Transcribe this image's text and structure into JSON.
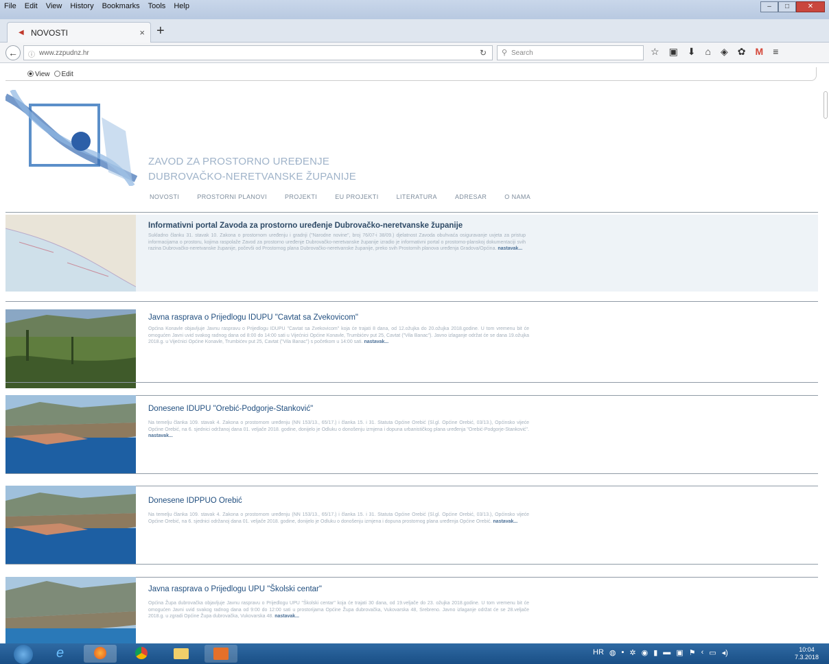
{
  "browser": {
    "menu": [
      "File",
      "Edit",
      "View",
      "History",
      "Bookmarks",
      "Tools",
      "Help"
    ],
    "tab_title": "NOVOSTI",
    "url": "www.zzpudnz.hr",
    "search_placeholder": "Search"
  },
  "page": {
    "mode_view": "View",
    "mode_edit": "Edit",
    "site_title_line1": "ZAVOD ZA PROSTORNO UREĐENJE",
    "site_title_line2": "DUBROVAČKO-NERETVANSKE ŽUPANIJE",
    "nav": [
      "NOVOSTI",
      "PROSTORNI PLANOVI",
      "PROJEKTI",
      "EU PROJEKTI",
      "LITERATURA",
      "ADRESAR",
      "O NAMA"
    ],
    "read_more": "nastavak...",
    "featured": {
      "title": "Informativni portal Zavoda za prostorno uređenje Dubrovačko-neretvanske županije",
      "text": "Sukladno članku 31. stavak 10. Zakona o prostornom uređenju i gradnji (\"Narodne novine\", broj 76/07-i 38/09.) djelatnost Zavoda obuhvaća osiguravanje uvjeta za pristup informacijama o prostoru, kojima raspolaže Zavod za prostorno uređenje Dubrovačko-neretvanske županije izradio je informativni portal o prostorno-planskoj dokumentaciji svih razina Dubrovačko-neretvanske županije, počevši od Prostornog plana Dubrovačko-neretvanske županije, preko svih Prostornih planova uređenja Gradova/Općina."
    },
    "articles": [
      {
        "title": "Javna rasprava o Prijedlogu IDUPU \"Cavtat sa Zvekovicom\"",
        "text": "Općina Konavle objavljuje Javnu raspravu o Prijedlogu IDUPU \"Cavtat sa Zvekovicom\" koja će trajati 8 dana, od 12.ožujka do 20.ožujka 2018.godine. U tom vremenu bit će omogućen Javni uvid svakog radnog dana od 8:00 do 14:00 sati u Vijećnici Općine Konavle, Trumbićev put 25, Cavtat (\"Vila Banac\"). Javno izlaganje održat će se dana 19.ožujka 2018.g. u Vijećnici Općine Konavle, Trumbićev put 25, Cavtat (\"Vila Banac\") s početkom u 14:00 sati."
      },
      {
        "title": "Donesene IDUPU \"Orebić-Podgorje-Stanković\"",
        "text": "Na temelju članka 109. stavak 4. Zakona o prostornom uređenju (NN 153/13., 65/17.) i članka 15. i 31. Statuta Općine Orebić (Sl.gl. Općine Orebić, 03/13.), Općinsko vijeće Općine Orebić, na 6. sjednici održanoj dana 01. veljače 2018. godine, donijelo je Odluku o donošenju izmjena i dopuna urbanističkog plana uređenja \"Orebić-Podgorje-Stanković\"."
      },
      {
        "title": "Donesene IDPPUO Orebić",
        "text": "Na temelju članka 109. stavak 4. Zakona o prostornom uređenju (NN 153/13., 65/17.) i članka 15. i 31. Statuta Općine Orebić (Sl.gl. Općine Orebić, 03/13.), Općinsko vijeće Općine Orebić, na 6. sjednici održanoj dana 01. veljače 2018. godine, donijelo je Odluku o donošenju izmjena i dopuna prostornog plana uređenja Općine Orebić."
      },
      {
        "title": "Javna rasprava o Prijedlogu UPU \"Školski centar\"",
        "text": "Općina Župa dubrovačka objavljuje Javnu raspravu o Prijedlogu UPU \"Školski centar\" koja će trajati 30 dana, od 19.veljače do 23. ožujka 2018.godine. U tom vremenu bit će omogućen Javni uvid svakog radnog dana od 9:00 do 12:00 sati u prostorijama Općine Župa dubrovačka, Vukovarska 48, Srebreno. Javno izlaganje održat će se 28.veljače 2018.g. u zgradi Općine Župa dubrovačka, Vukovarska 48."
      }
    ]
  },
  "taskbar": {
    "lang": "HR",
    "time": "10:04",
    "date": "7.3.2018"
  }
}
